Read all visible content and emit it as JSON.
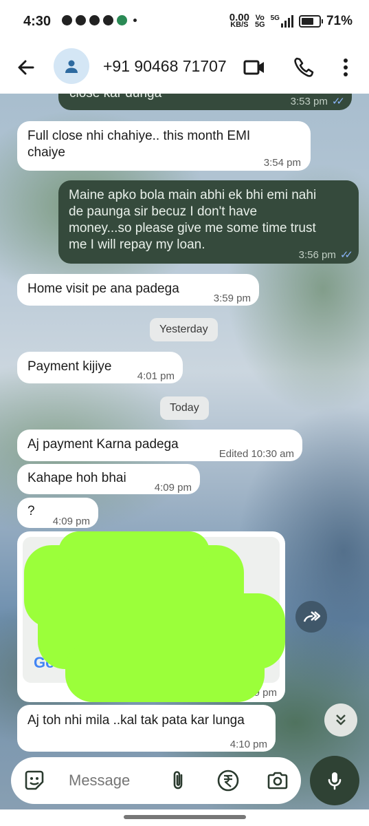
{
  "status_bar": {
    "time": "4:30",
    "net_speed": "0.00",
    "net_unit": "KB/S",
    "net_label1": "Vo",
    "net_label2": "5G",
    "net_type": "5G",
    "battery": "71%"
  },
  "header": {
    "contact": "+91 90468 71707"
  },
  "messages": [
    {
      "text": "close kar dunga",
      "time": "3:53 pm"
    },
    {
      "text": "Full close nhi chahiye.. this month EMI chaiye",
      "time": "3:54 pm"
    },
    {
      "text": "Maine apko bola main abhi ek bhi emi nahi de paunga sir becuz I don't have money...so please give me some time trust me I will repay my loan.",
      "time": "3:56 pm"
    },
    {
      "text": "Home visit pe ana padega",
      "time": "3:59 pm"
    },
    {
      "text": "Payment kijiye",
      "time": "4:01 pm"
    },
    {
      "text": "Aj  payment Karna padega",
      "time": "Edited 10:30 am"
    },
    {
      "text": "Kahape hoh bhai",
      "time": "4:09 pm"
    },
    {
      "text": "?",
      "time": "4:09 pm"
    },
    {
      "text": "Aj toh nhi mila ..kal tak pata kar lunga",
      "time": "4:10 pm"
    }
  ],
  "dates": {
    "yesterday": "Yesterday",
    "today": "Today"
  },
  "map_card": {
    "google_label": "Go",
    "time_partial": "4:09 pm"
  },
  "composer": {
    "placeholder": "Message"
  },
  "colors": {
    "outgoing_bubble": "#354a3c",
    "incoming_bubble": "#ffffff",
    "read_tick": "#8ab4f8",
    "redaction": "#9bff3a"
  }
}
